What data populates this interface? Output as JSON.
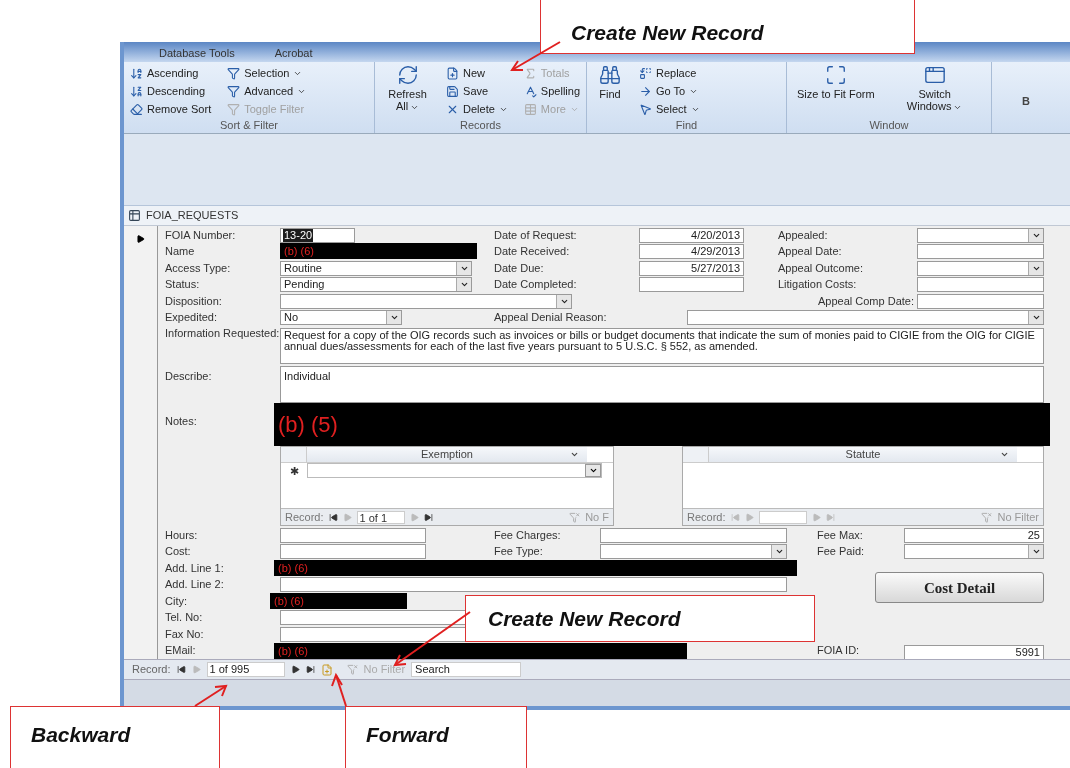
{
  "ribbon": {
    "tabs": [
      "Database Tools",
      "Acrobat"
    ],
    "groups": [
      {
        "label": "Sort & Filter",
        "items": [
          {
            "label": "Ascending",
            "kind": "small",
            "dropdown": false,
            "disabled": false
          },
          {
            "label": "Descending",
            "kind": "small",
            "dropdown": false,
            "disabled": false
          },
          {
            "label": "Remove Sort",
            "kind": "small",
            "dropdown": false,
            "disabled": false
          },
          {
            "label": "Selection",
            "kind": "small",
            "dropdown": true,
            "disabled": false
          },
          {
            "label": "Advanced",
            "kind": "small",
            "dropdown": true,
            "disabled": false
          },
          {
            "label": "Toggle Filter",
            "kind": "small",
            "dropdown": false,
            "disabled": true
          }
        ]
      },
      {
        "label": "Records",
        "items": [
          {
            "label": "Refresh All",
            "kind": "large",
            "dropdown": true,
            "disabled": false
          },
          {
            "label": "New",
            "kind": "small",
            "dropdown": false,
            "disabled": false
          },
          {
            "label": "Save",
            "kind": "small",
            "dropdown": false,
            "disabled": false
          },
          {
            "label": "Delete",
            "kind": "small",
            "dropdown": true,
            "disabled": false
          },
          {
            "label": "Totals",
            "kind": "small",
            "dropdown": false,
            "disabled": true
          },
          {
            "label": "Spelling",
            "kind": "small",
            "dropdown": false,
            "disabled": false
          },
          {
            "label": "More",
            "kind": "small",
            "dropdown": true,
            "disabled": true
          }
        ]
      },
      {
        "label": "Find",
        "items": [
          {
            "label": "Find",
            "kind": "large",
            "dropdown": false,
            "disabled": false
          },
          {
            "label": "Replace",
            "kind": "small",
            "dropdown": false,
            "disabled": false
          },
          {
            "label": "Go To",
            "kind": "small",
            "dropdown": true,
            "disabled": false
          },
          {
            "label": "Select",
            "kind": "small",
            "dropdown": true,
            "disabled": false
          }
        ]
      },
      {
        "label": "Window",
        "items": [
          {
            "label": "Size to Fit Form",
            "kind": "large",
            "dropdown": false,
            "disabled": false
          },
          {
            "label": "Switch Windows",
            "kind": "large",
            "dropdown": true,
            "disabled": false
          }
        ]
      }
    ],
    "cut_off_button": "B"
  },
  "form": {
    "title": "FOIA_REQUESTS",
    "top_fields": [
      {
        "label": "FOIA Number:",
        "value": "13-20",
        "kind": "text",
        "highlighted": true
      },
      {
        "label": "Date of Request:",
        "value": "4/20/2013",
        "kind": "date"
      },
      {
        "label": "Appealed:",
        "kind": "combo"
      },
      {
        "label": "Name",
        "value": "(b) (6)",
        "kind": "redacted"
      },
      {
        "label": "Date Received:",
        "value": "4/29/2013",
        "kind": "date"
      },
      {
        "label": "Appeal Date:",
        "kind": "text"
      },
      {
        "label": "Access Type:",
        "value": "Routine",
        "kind": "combo"
      },
      {
        "label": "Date Due:",
        "value": "5/27/2013",
        "kind": "date"
      },
      {
        "label": "Appeal Outcome:",
        "kind": "combo"
      },
      {
        "label": "Status:",
        "value": "Pending",
        "kind": "combo"
      },
      {
        "label": "Date Completed:",
        "kind": "text"
      },
      {
        "label": "Litigation Costs:",
        "kind": "text"
      },
      {
        "label": "Disposition:",
        "kind": "combo"
      },
      {
        "label": "Appeal Comp Date:",
        "kind": "text"
      },
      {
        "label": "Expedited:",
        "value": "No",
        "kind": "combo"
      },
      {
        "label": "Appeal Denial Reason:",
        "kind": "combo"
      }
    ],
    "information_requested": {
      "label": "Information Requested:",
      "value": "Request for a copy of the OIG records such as invoices or bills or budget documents that indicate the sum of monies paid to CIGIE from the OIG for CIGIE annual dues/assessments for each of the last five years pursuant to 5 U.S.C. § 552, as amended."
    },
    "describe": {
      "label": "Describe:",
      "value": "Individual"
    },
    "notes": {
      "label": "Notes:",
      "value": "(b) (5)"
    },
    "subforms": [
      {
        "column": "Exemption",
        "new_row_marker": "✱",
        "nav": {
          "label": "Record:",
          "position": "1 of 1",
          "filter": "No F"
        }
      },
      {
        "column": "Statute",
        "nav": {
          "label": "Record:",
          "filter": "No Filter"
        }
      }
    ],
    "bottom_fields": [
      {
        "label": "Hours:",
        "kind": "text"
      },
      {
        "label": "Fee Charges:",
        "kind": "text"
      },
      {
        "label": "Fee Max:",
        "value": "25",
        "kind": "number"
      },
      {
        "label": "Cost:",
        "kind": "text"
      },
      {
        "label": "Fee Type:",
        "kind": "combo"
      },
      {
        "label": "Fee Paid:",
        "kind": "combo"
      },
      {
        "label": "Add. Line 1:",
        "value": "(b) (6)",
        "kind": "redacted"
      },
      {
        "label": "Add. Line 2:",
        "kind": "text"
      },
      {
        "label": "City:",
        "value": "(b) (6)",
        "kind": "redacted"
      },
      {
        "label": "Tel. No:",
        "kind": "text"
      },
      {
        "label": "Fax No:",
        "kind": "text"
      },
      {
        "label": "EMail:",
        "value": "(b) (6)",
        "kind": "redacted"
      },
      {
        "label": "FOIA ID:",
        "value": "5991",
        "kind": "number"
      }
    ],
    "cost_detail_button": "Cost Detail"
  },
  "record_nav": {
    "label": "Record:",
    "position": "1 of 995",
    "filter": "No Filter",
    "filter_disabled": true,
    "search_placeholder": "Search"
  },
  "callouts": [
    "Create New Record",
    "Create New Record",
    "Backward",
    "Forward"
  ]
}
